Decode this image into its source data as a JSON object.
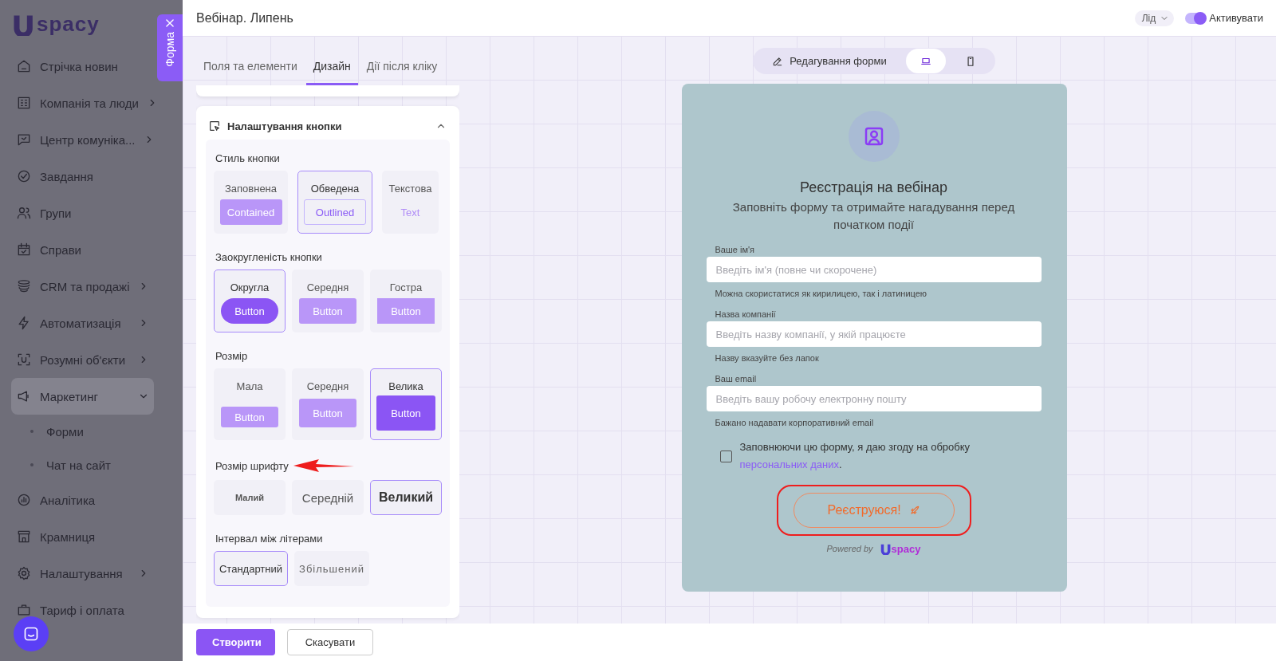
{
  "sidebar": {
    "logo": "spacy",
    "items": [
      {
        "label": "Стрічка новин",
        "kind": "item",
        "selected": false
      },
      {
        "label": "Компанія та люди",
        "kind": "group",
        "expanded": false,
        "selected": false
      },
      {
        "label": "Центр комуніка...",
        "kind": "group",
        "expanded": false,
        "selected": false
      },
      {
        "label": "Завдання",
        "kind": "item",
        "selected": false
      },
      {
        "label": "Групи",
        "kind": "item",
        "selected": false
      },
      {
        "label": "Справи",
        "kind": "item",
        "selected": false
      },
      {
        "label": "CRM та продажі",
        "kind": "group",
        "expanded": false,
        "selected": false
      },
      {
        "label": "Автоматизація",
        "kind": "group",
        "expanded": false,
        "selected": false
      },
      {
        "label": "Розумні об'єкти",
        "kind": "group",
        "expanded": false,
        "selected": false
      },
      {
        "label": "Маркетинг",
        "kind": "group",
        "expanded": true,
        "selected": true,
        "children": [
          {
            "label": "Форми"
          },
          {
            "label": "Чат на сайт"
          }
        ]
      },
      {
        "label": "Аналітика",
        "kind": "item",
        "selected": false
      },
      {
        "label": "Крамниця",
        "kind": "item",
        "selected": false
      },
      {
        "label": "Налаштування",
        "kind": "group",
        "expanded": false,
        "selected": false
      },
      {
        "label": "Тариф і оплата",
        "kind": "item",
        "selected": false
      }
    ]
  },
  "side_tab": {
    "label": "Форма"
  },
  "header": {
    "title": "Вебінар. Липень",
    "type_dropdown": "Лід",
    "toggle": {
      "on": true,
      "label": "Активувати"
    }
  },
  "panel": {
    "tabs": [
      {
        "label": "Поля та елементи",
        "selected": false
      },
      {
        "label": "Дизайн",
        "selected": true
      },
      {
        "label": "Дії після кліку",
        "selected": false
      }
    ],
    "card": {
      "title": "Налаштування кнопки",
      "expanded": true,
      "sections": [
        {
          "label": "Стиль кнопки",
          "kind": "style",
          "options": [
            {
              "label": "Заповнена",
              "sample": "Contained",
              "kind": "contained",
              "selected": false
            },
            {
              "label": "Обведена",
              "sample": "Outlined",
              "kind": "outlined",
              "selected": true
            },
            {
              "label": "Текстова",
              "sample": "Text",
              "kind": "text",
              "selected": false
            }
          ]
        },
        {
          "label": "Заокругленість кнопки",
          "kind": "radius",
          "options": [
            {
              "label": "Округла",
              "sample": "Button",
              "kind": "round",
              "selected": true
            },
            {
              "label": "Середня",
              "sample": "Button",
              "kind": "medium",
              "selected": false
            },
            {
              "label": "Гостра",
              "sample": "Button",
              "kind": "sharp",
              "selected": false
            }
          ]
        },
        {
          "label": "Розмір",
          "kind": "size",
          "options": [
            {
              "label": "Мала",
              "sample": "Button",
              "kind": "small",
              "selected": false
            },
            {
              "label": "Середня",
              "sample": "Button",
              "kind": "medium",
              "selected": false
            },
            {
              "label": "Велика",
              "sample": "Button",
              "kind": "large",
              "selected": true
            }
          ]
        },
        {
          "label": "Розмір шрифту",
          "kind": "font",
          "options": [
            {
              "label": "Малий",
              "kind": "small",
              "selected": false
            },
            {
              "label": "Середній",
              "kind": "medium",
              "selected": false
            },
            {
              "label": "Великий",
              "kind": "large",
              "selected": true
            }
          ]
        },
        {
          "label": "Інтервал між літерами",
          "kind": "spacing",
          "options": [
            {
              "label": "Стандартний",
              "kind": "normal",
              "selected": true
            },
            {
              "label": "Збільшений",
              "kind": "wide",
              "selected": false
            }
          ]
        }
      ]
    },
    "buttons": [
      {
        "label": "Створити",
        "kind": "primary"
      },
      {
        "label": "Скасувати",
        "kind": "secondary"
      }
    ]
  },
  "preview": {
    "modes": [
      {
        "kind": "edit",
        "label": "Редагування форми",
        "selected": false
      },
      {
        "kind": "desktop",
        "selected": true
      },
      {
        "kind": "mobile",
        "selected": false
      }
    ],
    "form": {
      "title": "Реєстрація на вебінар",
      "subtitle": "Заповніть форму та отримайте нагадування перед початком події",
      "fields": [
        {
          "label": "Ваше ім'я",
          "placeholder": "Введіть ім'я (повне чи скорочене)",
          "hint": "Можна скористатися як кирилицею, так і латиницею"
        },
        {
          "label": "Назва компанії",
          "placeholder": "Введіть назву компанії, у якій працюєте",
          "hint": "Назву вказуйте без лапок"
        },
        {
          "label": "Ваш email",
          "placeholder": "Введіть вашу робочу електронну пошту",
          "hint": "Бажано надавати корпоративний email"
        }
      ],
      "consent": {
        "checked": false,
        "text": "Заповнюючи цю форму, я даю згоду на обробку",
        "link": "персональних даних",
        "after": "."
      },
      "submit": "Реєструюся!",
      "powered_by": "Powered by",
      "logo": "spacy"
    }
  }
}
